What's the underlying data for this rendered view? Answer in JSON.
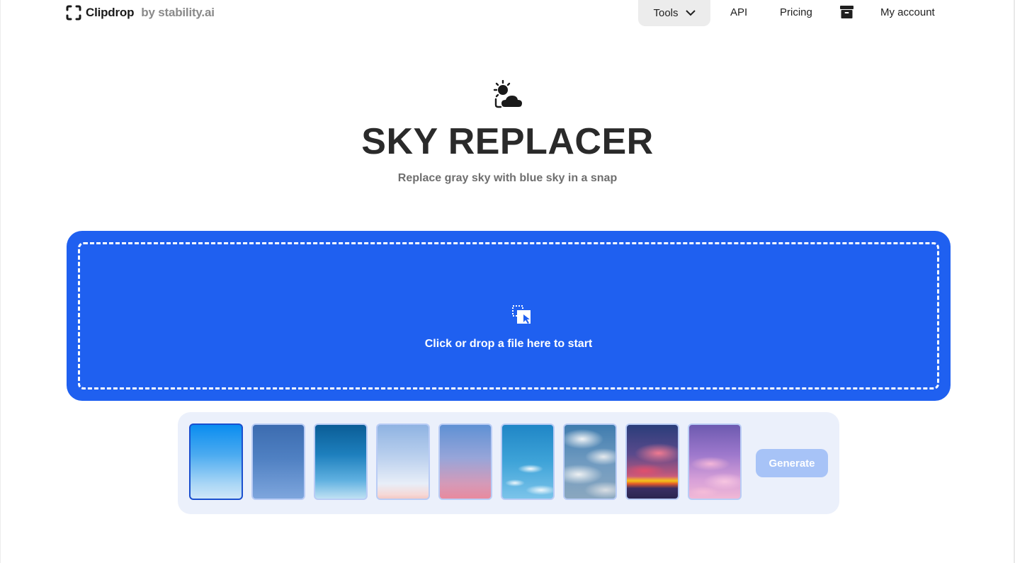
{
  "header": {
    "brand_name": "Clipdrop",
    "brand_by": "by stability.ai",
    "tools_label": "Tools",
    "api_label": "API",
    "pricing_label": "Pricing",
    "account_label": "My account"
  },
  "hero": {
    "title": "SKY REPLACER",
    "subtitle": "Replace gray sky with blue sky in a snap"
  },
  "dropzone": {
    "text": "Click or drop a file here to start"
  },
  "sky_picker": {
    "selected_index": 0,
    "generate_label": "Generate"
  },
  "colors": {
    "accent": "#1f60f0",
    "picker_bg": "#ebf0fb",
    "generate_disabled": "#a7c3f7"
  }
}
